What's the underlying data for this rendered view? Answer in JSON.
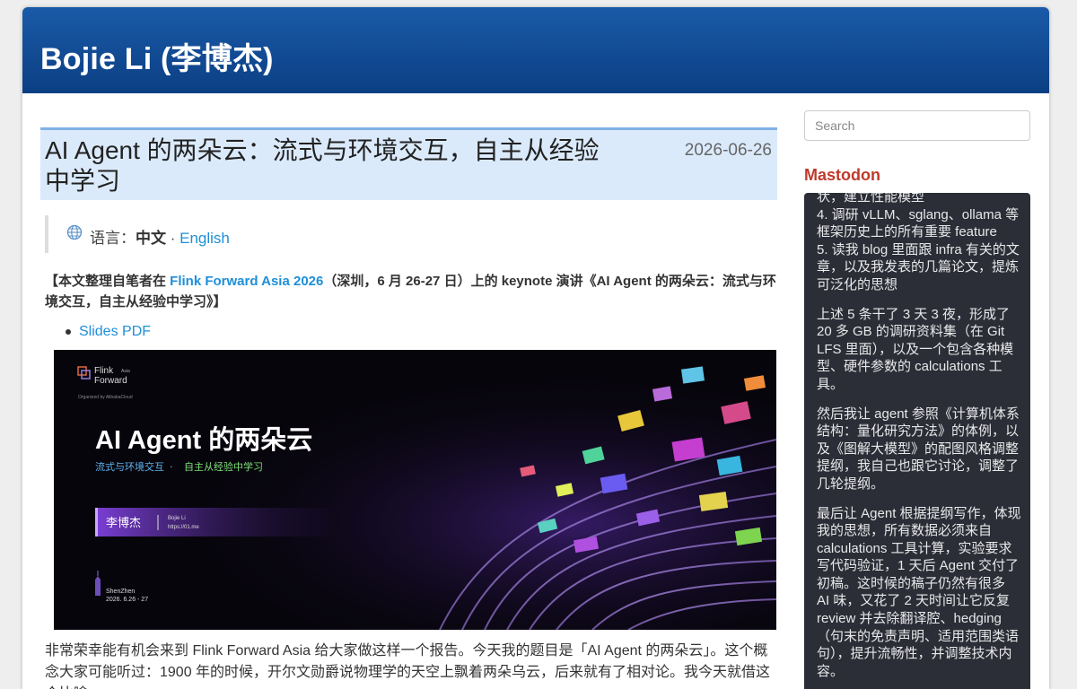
{
  "site": {
    "title": "Bojie Li (李博杰)"
  },
  "post": {
    "title": "AI Agent 的两朵云：流式与环境交互，自主从经验中学习",
    "date": "2026-06-26",
    "language": {
      "label": "语言：",
      "current": "中文",
      "sep": " · ",
      "alt": "English"
    },
    "intro": {
      "prefix": "【本文整理自笔者在 ",
      "link": "Flink Forward Asia 2026",
      "suffix": "（深圳，6 月 26-27 日）上的 keynote 演讲《AI Agent 的两朵云：流式与环境交互，自主从经验中学习》】"
    },
    "slides_link": "Slides PDF",
    "slide": {
      "brand_line1": "Flink",
      "brand_line2": "Forward",
      "brand_tag": "Asia",
      "organizer": "Organized by AlibabaCloud",
      "headline": "AI Agent 的两朵云",
      "sub_left": "流式与环境交互",
      "sub_dot": "·",
      "sub_right": "自主从经验中学习",
      "speaker": "李博杰",
      "speaker_en": "Bojie Li",
      "speaker_url": "https://01.me",
      "city": "ShenZhen",
      "dates": "2026. 6.26 - 27"
    },
    "body": "非常荣幸能有机会来到 Flink Forward Asia 给大家做这样一个报告。今天我的题目是「AI Agent 的两朵云」。这个概念大家可能听过：1900 年的时候，开尔文勋爵说物理学的天空上飘着两朵乌云，后来就有了相对论。我今天就借这个比喻，"
  },
  "sidebar": {
    "search_placeholder": "Search",
    "mastodon_heading": "Mastodon",
    "toots": [
      "状，建立性能模型\n4. 调研 vLLM、sglang、ollama 等框架历史上的所有重要 feature\n5. 读我 blog 里面跟 infra 有关的文章，以及我发表的几篇论文，提炼可泛化的思想",
      "上述 5 条干了 3 天 3 夜，形成了 20 多 GB 的调研资料集（在 Git LFS 里面），以及一个包含各种模型、硬件参数的 calculations 工具。",
      "然后我让 agent 参照《计算机体系结构：量化研究方法》的体例，以及《图解大模型》的配图风格调整提纲，我自己也跟它讨论，调整了几轮提纲。",
      "最后让 Agent 根据提纲写作，体现我的思想，所有数据必须来自 calculations 工具计算，实验要求写代码验证，1 天后 Agent 交付了初稿。这时候的稿子仍然有很多 AI 味，又花了 2 天时间让它反复 review 并去除翻译腔、hedging（句末的免责声明、适用范围类语句），提升流畅性，并调整技术内容。"
    ]
  },
  "colors": {
    "header": "#0b3f83",
    "link": "#1e8fd8",
    "mastodon_bg": "#2b2e36",
    "mastodon_heading": "#c0392b"
  }
}
